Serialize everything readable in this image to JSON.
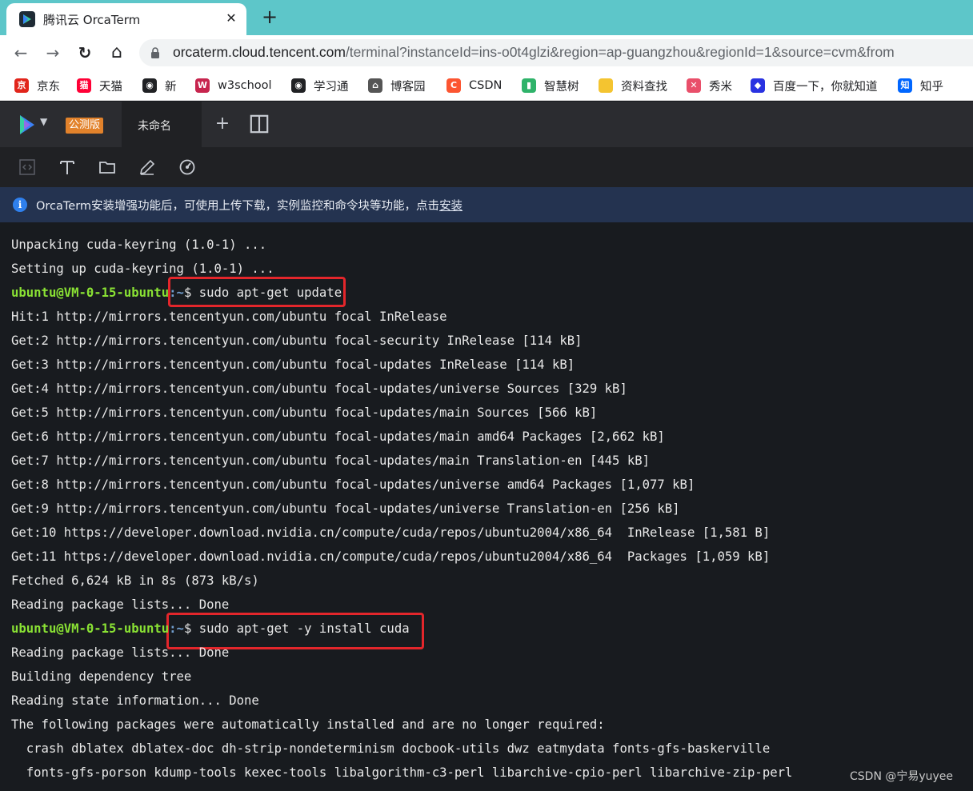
{
  "browser": {
    "tab_title": "腾讯云 OrcaTerm",
    "close_glyph": "✕",
    "new_tab_glyph": "+",
    "back_glyph": "←",
    "forward_glyph": "→",
    "reload_glyph": "↻",
    "home_glyph": "⌂",
    "url_host": "orcaterm.cloud.tencent.com",
    "url_path": "/terminal?instanceId=ins-o0t4glzi&region=ap-guangzhou&regionId=1&source=cvm&from"
  },
  "bookmarks": [
    {
      "label": "京东",
      "icon": "jd-icon",
      "color": "#e1251b"
    },
    {
      "label": "天猫",
      "icon": "tmall-icon",
      "color": "#ff0036"
    },
    {
      "label": "新",
      "icon": "globe-icon",
      "color": "#202124"
    },
    {
      "label": "w3school",
      "icon": "w3school-icon",
      "color": "#c7254e"
    },
    {
      "label": "学习通",
      "icon": "globe-icon",
      "color": "#202124"
    },
    {
      "label": "博客园",
      "icon": "cnblogs-icon",
      "color": "#555555"
    },
    {
      "label": "CSDN",
      "icon": "csdn-icon",
      "color": "#fc5531"
    },
    {
      "label": "智慧树",
      "icon": "zhihuishu-icon",
      "color": "#2fb36a"
    },
    {
      "label": "资料查找",
      "icon": "folder-icon",
      "color": "#f4c430"
    },
    {
      "label": "秀米",
      "icon": "xiumi-icon",
      "color": "#e94f6a"
    },
    {
      "label": "百度一下，你就知道",
      "icon": "baidu-icon",
      "color": "#2932e1"
    },
    {
      "label": "知乎",
      "icon": "zhihu-icon",
      "color": "#0066ff"
    }
  ],
  "orcaterm": {
    "beta_badge": "公测版",
    "session_tab": "未命名",
    "add_glyph": "+",
    "banner_text": "OrcaTerm安装增强功能后，可使用上传下载，实例监控和命令块等功能，点击",
    "banner_link": "安装",
    "info_glyph": "i"
  },
  "terminal": {
    "prompt_user": "ubuntu@VM-0-15-ubuntu",
    "prompt_path": ":~",
    "prompt_sign": "$ ",
    "lines": [
      "Unpacking cuda-keyring (1.0-1) ...",
      "Setting up cuda-keyring (1.0-1) ...",
      "sudo apt-get update",
      "Hit:1 http://mirrors.tencentyun.com/ubuntu focal InRelease",
      "Get:2 http://mirrors.tencentyun.com/ubuntu focal-security InRelease [114 kB]",
      "Get:3 http://mirrors.tencentyun.com/ubuntu focal-updates InRelease [114 kB]",
      "Get:4 http://mirrors.tencentyun.com/ubuntu focal-updates/universe Sources [329 kB]",
      "Get:5 http://mirrors.tencentyun.com/ubuntu focal-updates/main Sources [566 kB]",
      "Get:6 http://mirrors.tencentyun.com/ubuntu focal-updates/main amd64 Packages [2,662 kB]",
      "Get:7 http://mirrors.tencentyun.com/ubuntu focal-updates/main Translation-en [445 kB]",
      "Get:8 http://mirrors.tencentyun.com/ubuntu focal-updates/universe amd64 Packages [1,077 kB]",
      "Get:9 http://mirrors.tencentyun.com/ubuntu focal-updates/universe Translation-en [256 kB]",
      "Get:10 https://developer.download.nvidia.cn/compute/cuda/repos/ubuntu2004/x86_64  InRelease [1,581 B]",
      "Get:11 https://developer.download.nvidia.cn/compute/cuda/repos/ubuntu2004/x86_64  Packages [1,059 kB]",
      "Fetched 6,624 kB in 8s (873 kB/s)",
      "Reading package lists... Done",
      "sudo apt-get -y install cuda",
      "Reading package lists... Done",
      "Building dependency tree",
      "Reading state information... Done",
      "The following packages were automatically installed and are no longer required:",
      "  crash dblatex dblatex-doc dh-strip-nondeterminism docbook-utils dwz eatmydata fonts-gfs-baskerville",
      "  fonts-gfs-porson kdump-tools kexec-tools libalgorithm-c3-perl libarchive-cpio-perl libarchive-zip-perl"
    ]
  },
  "watermark": "CSDN @宁易yuyee",
  "colors": {
    "prompt_user": "#8ae234",
    "highlight": "#e3262b",
    "terminal_bg": "#181b1f"
  }
}
